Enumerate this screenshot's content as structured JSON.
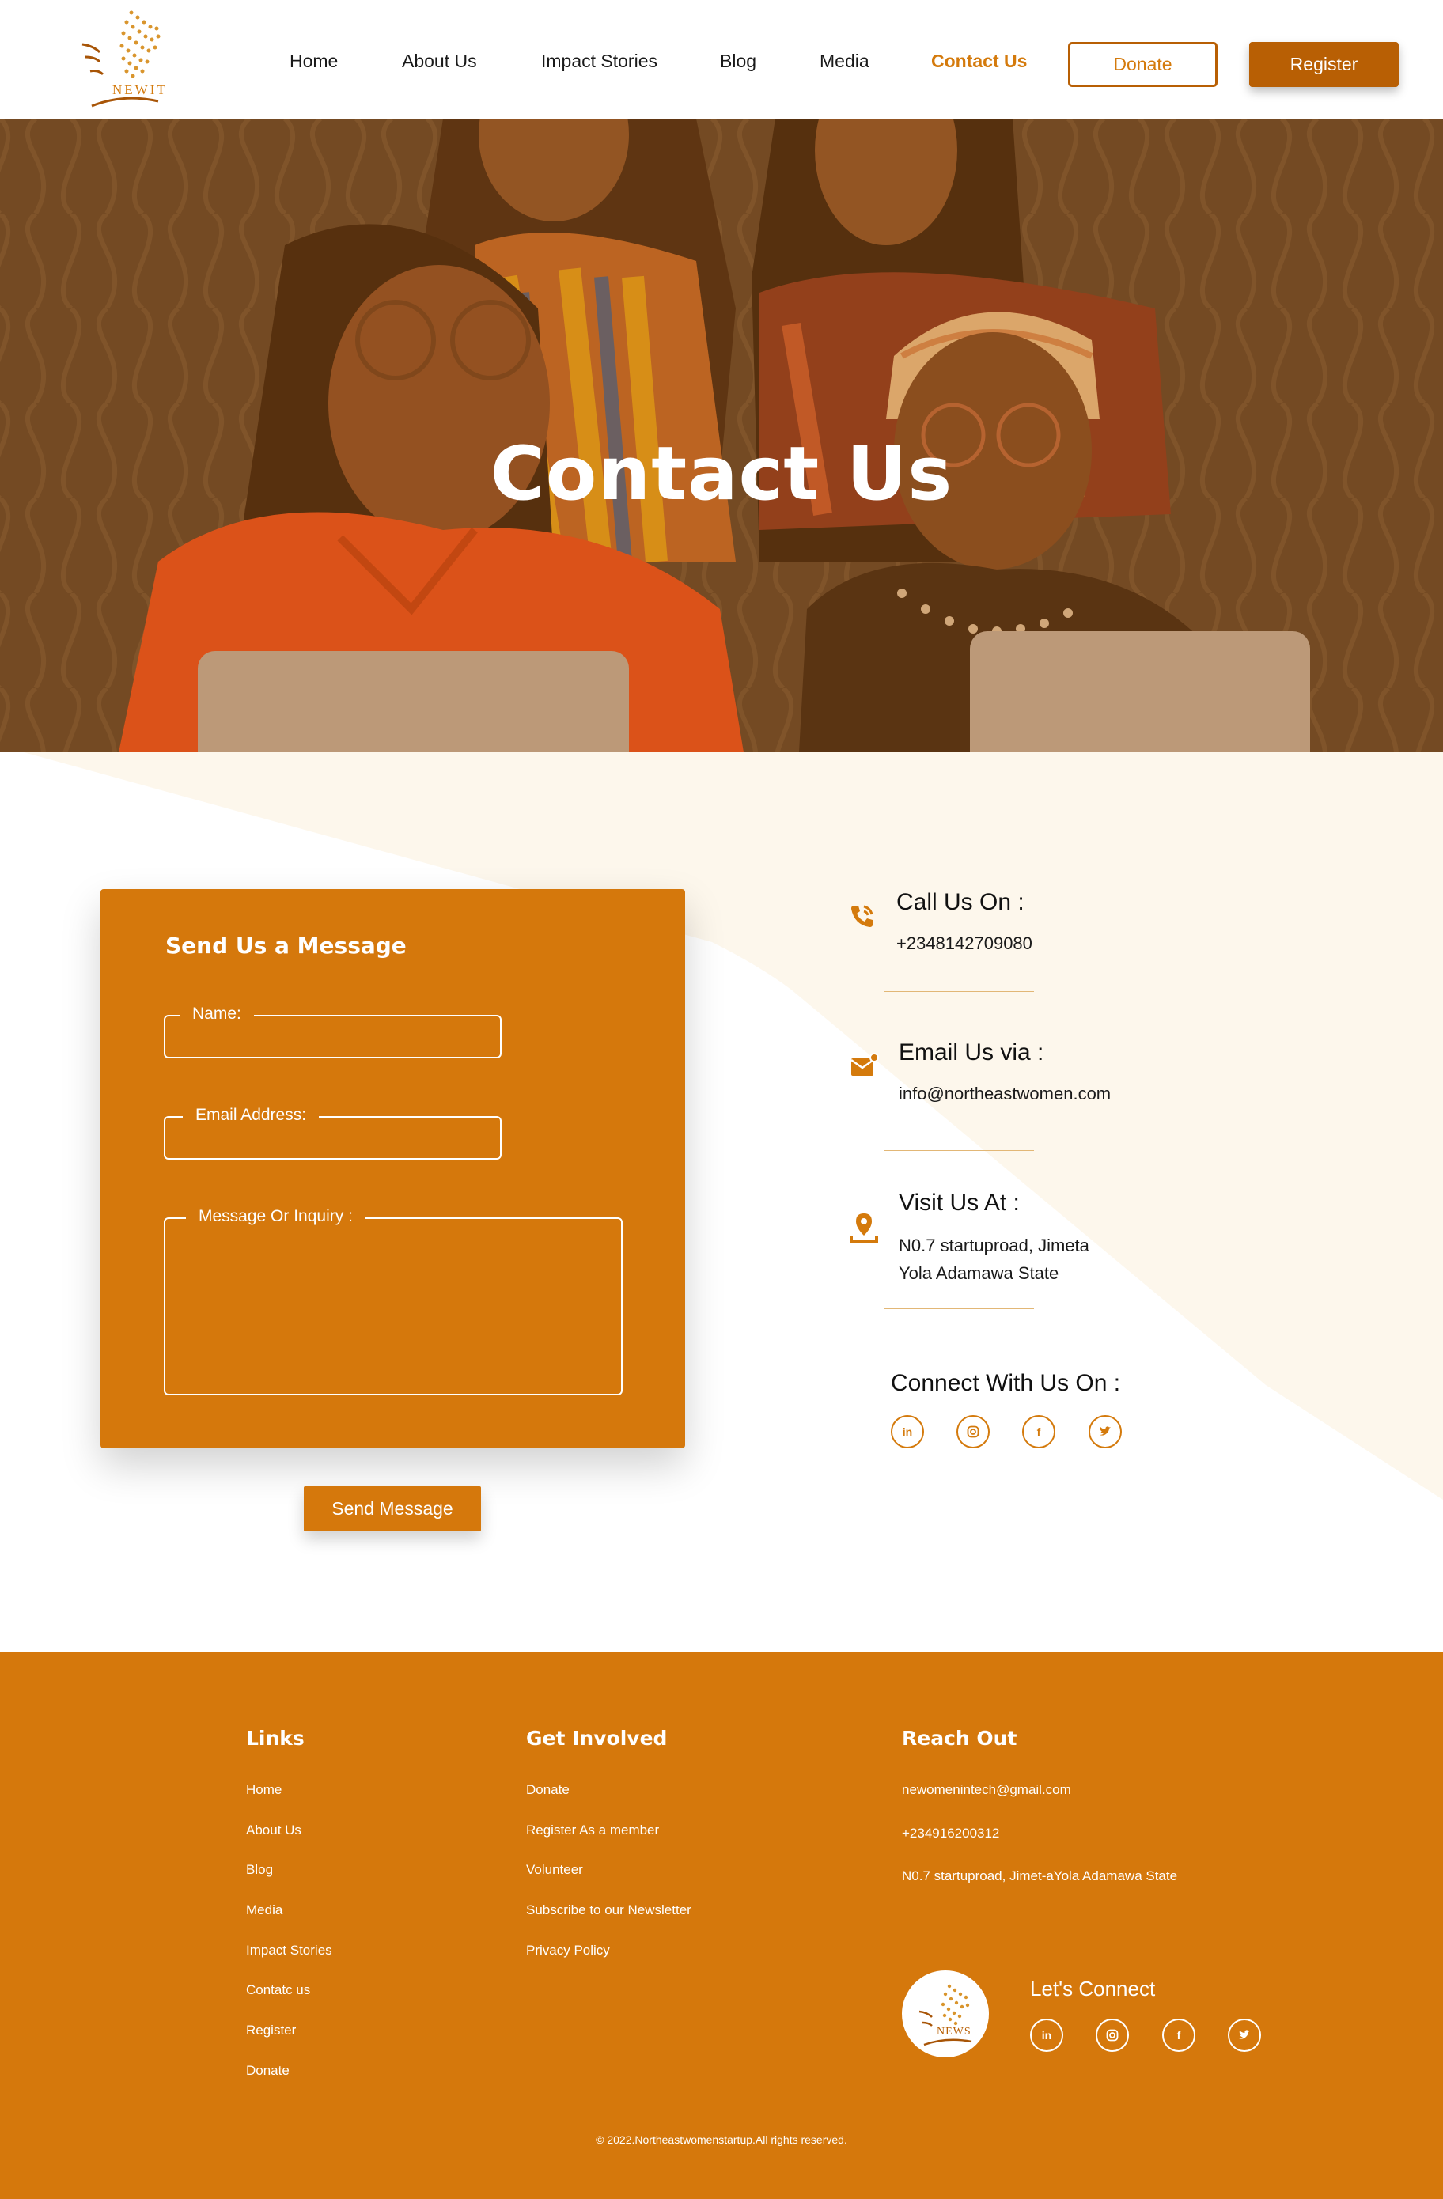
{
  "header": {
    "logo_text": "NEWIT",
    "nav": [
      "Home",
      "About Us",
      "Impact Stories",
      "Blog",
      "Media",
      "Contact Us"
    ],
    "active_nav": "Contact Us",
    "donate_label": "Donate",
    "register_label": "Register"
  },
  "hero": {
    "title": "Contact Us"
  },
  "form": {
    "title": "Send Us a Message",
    "name_label": "Name:",
    "email_label": "Email Address:",
    "message_label": "Message Or Inquiry :",
    "send_label": "Send Message"
  },
  "contact_info": {
    "call_heading": "Call Us On :",
    "phone": "+2348142709080",
    "email_heading": "Email Us via :",
    "email": "info@northeastwomen.com",
    "visit_heading": "Visit Us At :",
    "address_line1": "N0.7 startuproad, Jimeta",
    "address_line2": "Yola Adamawa State",
    "connect_heading": "Connect With Us On :",
    "social": [
      "in",
      "ig",
      "f",
      "t"
    ]
  },
  "footer": {
    "links_heading": "Links",
    "links": [
      "Home",
      "About Us",
      "Blog",
      "Media",
      "Impact Stories",
      "Contatc us",
      "Register",
      "Donate"
    ],
    "involved_heading": "Get Involved",
    "involved": [
      "Donate",
      "Register As a member",
      "Volunteer",
      "Subscribe to our Newsletter",
      "Privacy Policy"
    ],
    "reach_heading": "Reach Out",
    "reach_email": "newomenintech@gmail.com",
    "reach_phone": "+234916200312",
    "reach_address": "N0.7 startuproad, Jimet-aYola Adamawa State",
    "logo_text": "NEWS",
    "connect_label": "Let's Connect",
    "copyright_symbol": "©",
    "copyright": "2022.Northeastwomenstartup.All rights reserved."
  },
  "colors": {
    "brand_orange": "#d5780c",
    "dark_orange": "#b85f04",
    "cream": "#fdf7ec"
  }
}
